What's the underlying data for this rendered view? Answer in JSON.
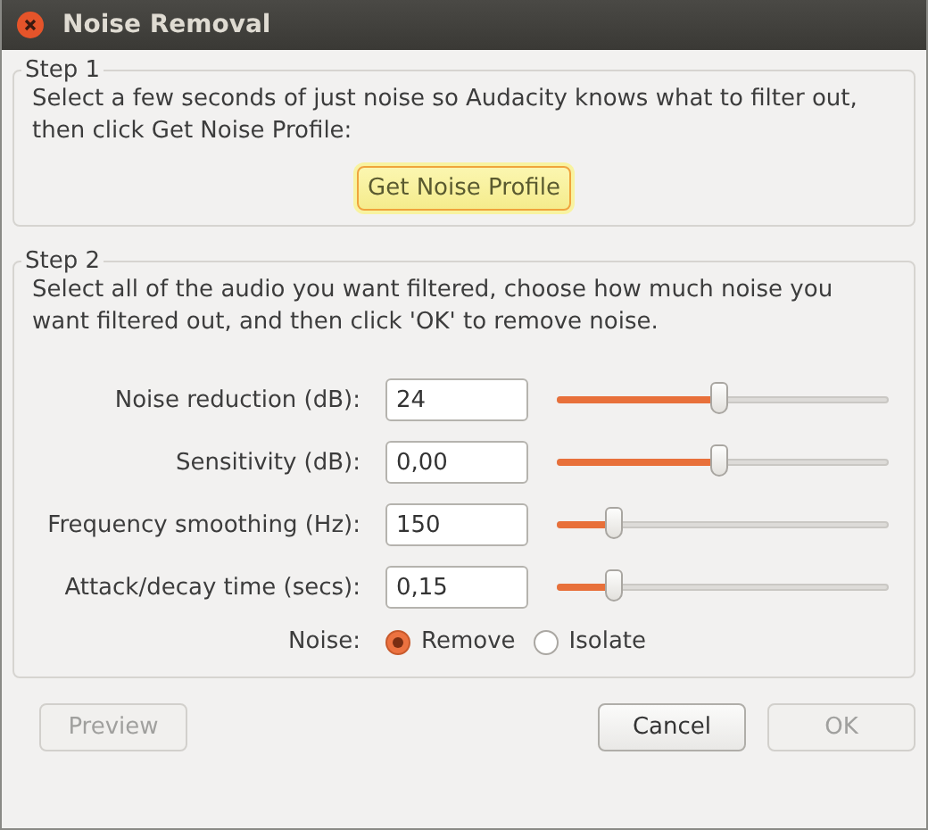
{
  "window": {
    "title": "Noise Removal"
  },
  "step1": {
    "title": "Step 1",
    "text": "Select a few seconds of just noise so Audacity knows what to filter out, then click Get Noise Profile:",
    "button": "Get Noise Profile"
  },
  "step2": {
    "title": "Step 2",
    "text": "Select all of the audio you want filtered, choose how much noise you want filtered out, and then click 'OK' to remove noise.",
    "settings": [
      {
        "label": "Noise reduction (dB):",
        "value": "24",
        "level": 0.49
      },
      {
        "label": "Sensitivity (dB):",
        "value": "0,00",
        "level": 0.49
      },
      {
        "label": "Frequency smoothing (Hz):",
        "value": "150",
        "level": 0.17
      },
      {
        "label": "Attack/decay time (secs):",
        "value": "0,15",
        "level": 0.17
      }
    ],
    "noise": {
      "label": "Noise:",
      "options": [
        {
          "label": "Remove",
          "selected": true
        },
        {
          "label": "Isolate",
          "selected": false
        }
      ]
    }
  },
  "buttons": [
    {
      "label": "Preview",
      "disabled": true
    },
    {
      "label": "Cancel",
      "disabled": false
    },
    {
      "label": "OK",
      "disabled": true
    }
  ]
}
